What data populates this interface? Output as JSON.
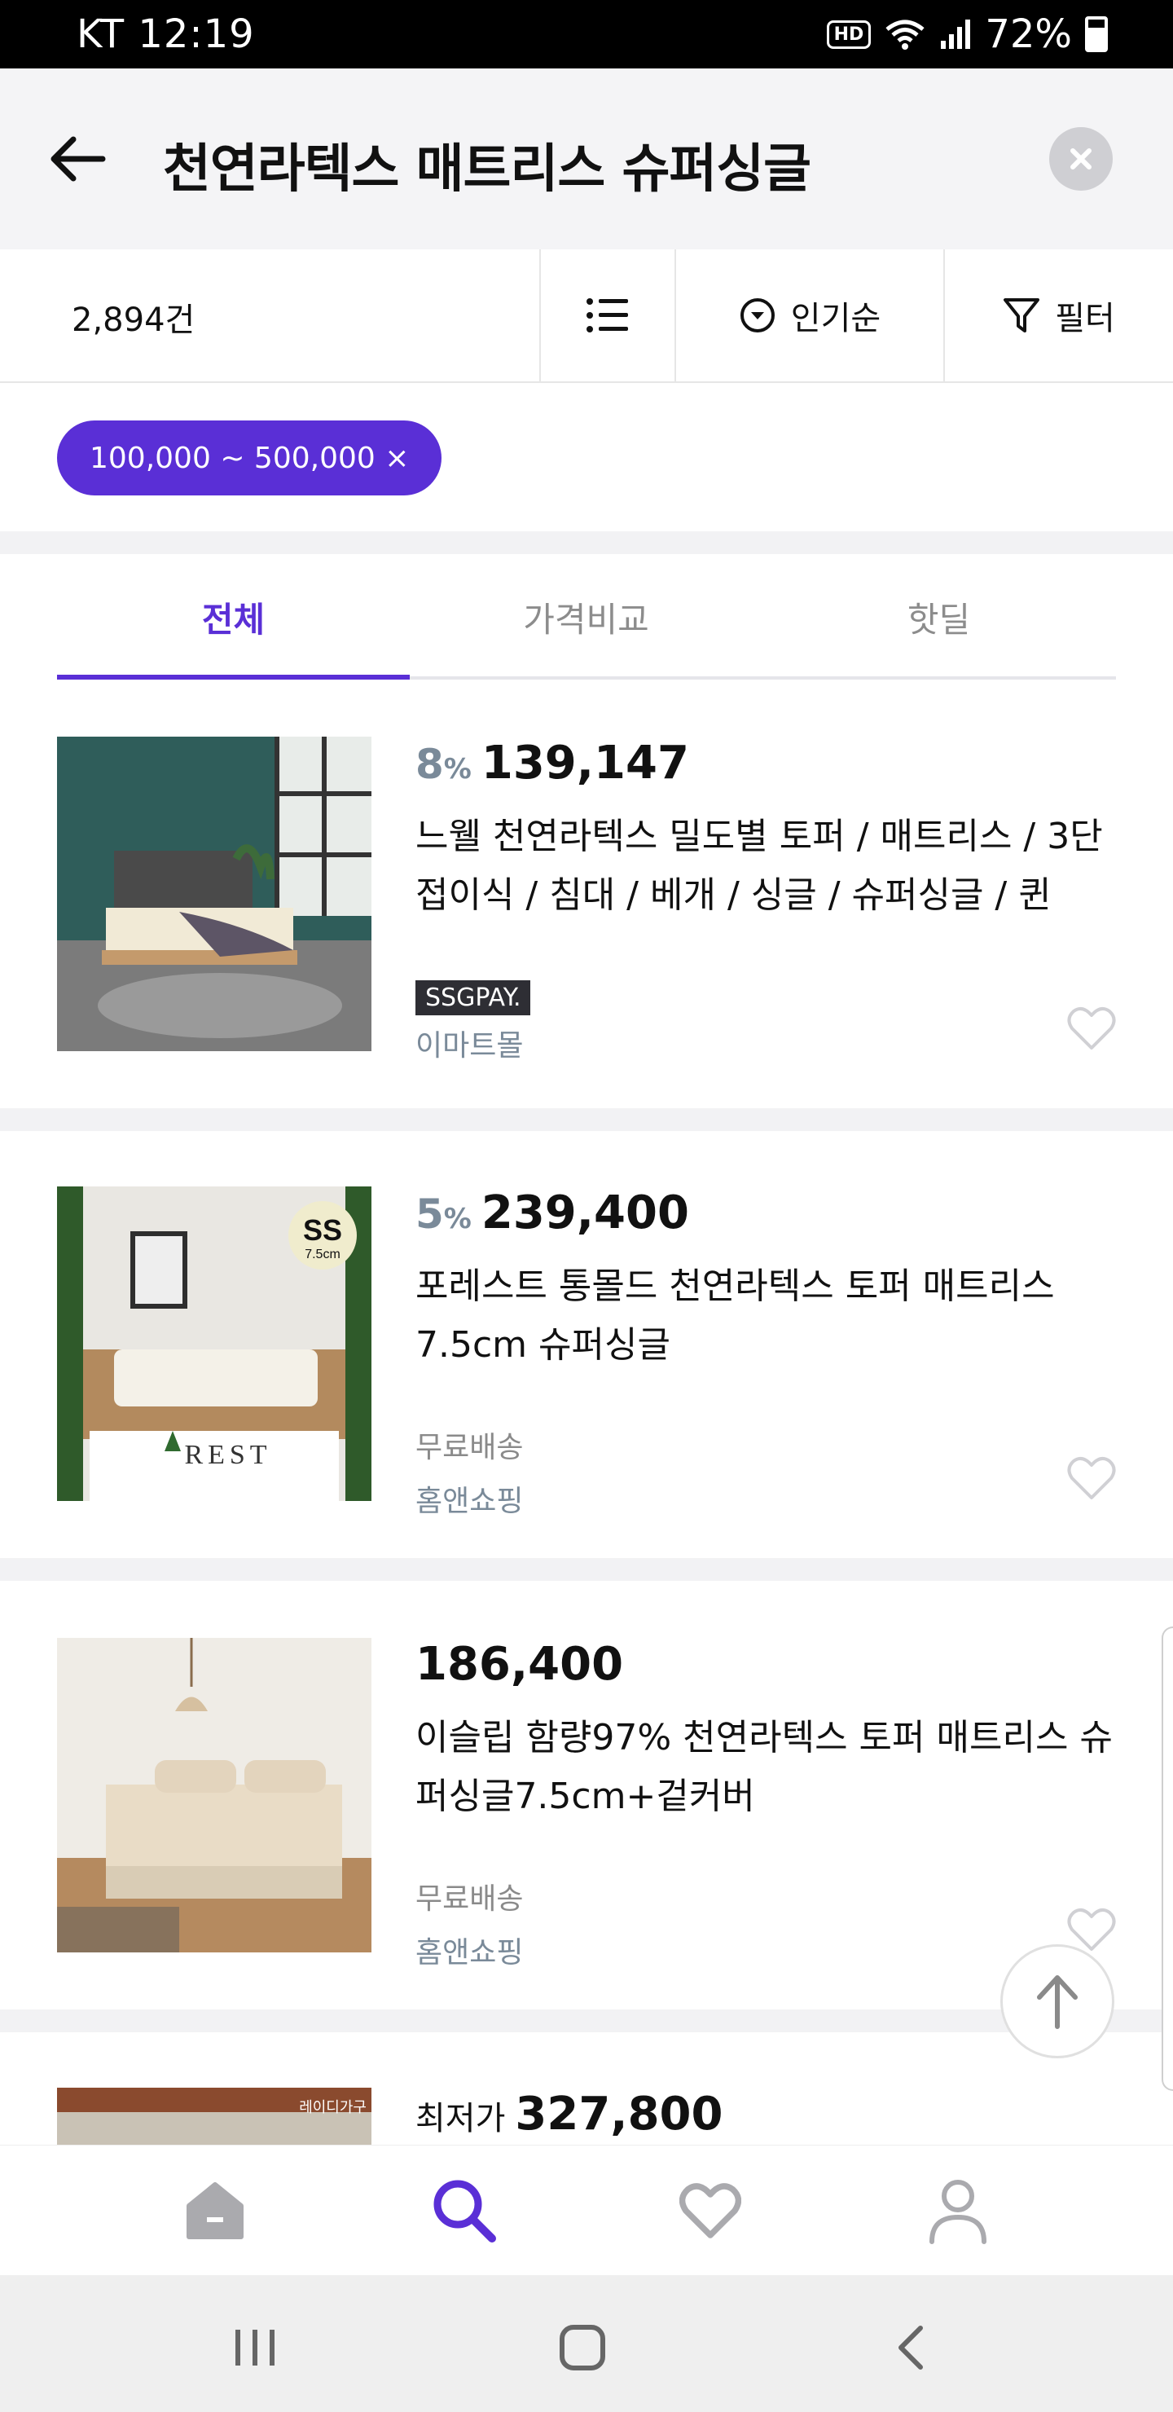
{
  "status_bar": {
    "carrier_time": "KT 12:19",
    "hd": "HD",
    "battery": "72%"
  },
  "header": {
    "query": "천연라텍스 매트리스 슈퍼싱글"
  },
  "toolbar": {
    "count": "2,894건",
    "sort_label": "인기순",
    "filter_label": "필터"
  },
  "active_filter_chip": "100,000 ~ 500,000 ×",
  "tabs": [
    {
      "label": "전체",
      "active": true
    },
    {
      "label": "가격비교",
      "active": false
    },
    {
      "label": "핫딜",
      "active": false
    }
  ],
  "products": [
    {
      "discount": "8",
      "discount_unit": "%",
      "price": "139,147",
      "title": "느웰 천연라텍스 밀도별 토퍼 / 매트리스 / 3단 접이식 / 침대 / 베개 / 싱글 / 슈퍼싱글 / 퀸",
      "badge": "SSGPAY.",
      "mall": "이마트몰"
    },
    {
      "discount": "5",
      "discount_unit": "%",
      "price": "239,400",
      "title": "포레스트 통몰드 천연라텍스 토퍼 매트리스 7.5cm 슈퍼싱글",
      "shipping": "무료배송",
      "mall": "홈앤쇼핑",
      "thumb_badge": "SS",
      "thumb_badge_sub": "7.5cm",
      "thumb_brand": "REST"
    },
    {
      "price": "186,400",
      "title": "이슬립 함량97% 천연라텍스 토퍼 매트리스 슈퍼싱글7.5cm+겉커버",
      "shipping": "무료배송",
      "mall": "홈앤쇼핑"
    },
    {
      "price_label": "최저가",
      "price": "327,800",
      "thumb_brand": "레이디가구"
    }
  ],
  "colors": {
    "accent": "#5a2fd6",
    "discount": "#7a8a99",
    "mall": "#7a8a99"
  }
}
